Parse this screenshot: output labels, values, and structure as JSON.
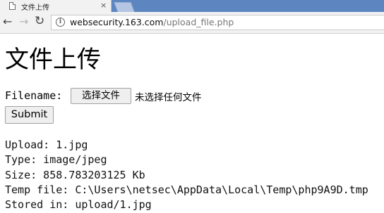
{
  "tab": {
    "title": "文件上传",
    "close_glyph": "×",
    "icon": "page-icon"
  },
  "toolbar": {
    "back_glyph": "←",
    "forward_glyph": "→",
    "reload_glyph": "↻",
    "info_glyph": "i",
    "url_host": "websecurity.163.com",
    "url_path": "/upload_file.php"
  },
  "page": {
    "heading": "文件上传",
    "filename_label": "Filename:",
    "choose_file_label": "选择文件",
    "no_file_text": "未选择任何文件",
    "submit_label": "Submit",
    "result_lines": [
      "Upload: 1.jpg",
      "Type: image/jpeg",
      "Size: 858.783203125 Kb",
      "Temp file: C:\\Users\\netsec\\AppData\\Local\\Temp\\php9A9D.tmp",
      "Stored in: upload/1.jpg"
    ]
  }
}
